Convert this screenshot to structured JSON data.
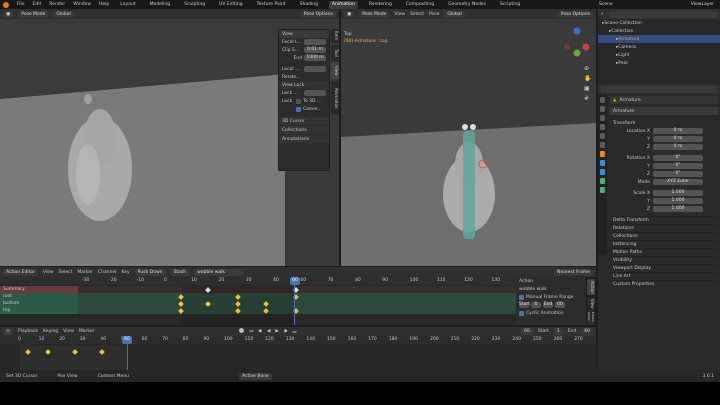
{
  "topbar": {
    "menus": [
      "File",
      "Edit",
      "Render",
      "Window",
      "Help"
    ],
    "workspaces": [
      "Layout",
      "Modeling",
      "Sculpting",
      "UV Editing",
      "Texture Paint",
      "Shading",
      "Animation",
      "Rendering",
      "Compositing",
      "Geometry Nodes",
      "Scripting"
    ],
    "active_workspace": "Animation",
    "scene": "Scene",
    "view_layer": "ViewLayer"
  },
  "left_viewport": {
    "mode": "Pose Mode",
    "orientation": "Global",
    "pose_options": "Pose Options",
    "side_tabs": [
      "Item",
      "Tool",
      "View",
      "Animation"
    ],
    "view_panel": {
      "title": "View",
      "focal_label": "Focal L...",
      "clip_start_label": "Clip S...",
      "clip_start_value": "0.01 m",
      "end_label": "End",
      "end_value": "1000 m",
      "local_label": "Local ...",
      "render_label": "Rende...",
      "view_lock_title": "View Lock",
      "lock_obj_label": "Lock ...",
      "lock_label": "Lock",
      "to_3d_label": "To 3D ...",
      "camera_label": "Camer...",
      "sections": [
        "3D Cursor",
        "Collections",
        "Annotations"
      ]
    }
  },
  "right_viewport": {
    "mode": "Pose Mode",
    "menus": [
      "View",
      "Select",
      "Pose"
    ],
    "orientation": "Global",
    "pose_options": "Pose Options",
    "info_line1": "Top",
    "info_line2": "(60) Armature : top"
  },
  "outliner": {
    "items": [
      {
        "label": "Scene Collection",
        "indent": 0,
        "color": "#c8c8c8"
      },
      {
        "label": "Collection",
        "indent": 1,
        "color": "#c8c8c8"
      },
      {
        "label": "Armature",
        "indent": 2,
        "color": "#e89a3c",
        "selected": true
      },
      {
        "label": "Camera",
        "indent": 2,
        "color": "#c8c8c8"
      },
      {
        "label": "Light",
        "indent": 2,
        "color": "#c8c8c8"
      },
      {
        "label": "Pear",
        "indent": 2,
        "color": "#c8c8c8"
      }
    ]
  },
  "properties": {
    "object_name": "Armature",
    "data_name": "Armature",
    "transform_title": "Transform",
    "location_label": "Location X",
    "location": [
      "0 m",
      "0 m",
      "0 m"
    ],
    "rotation_label": "Rotation X",
    "rotation": [
      "0°",
      "0°",
      "0°"
    ],
    "mode_label": "Mode",
    "mode_value": "XYZ Euler",
    "scale_label": "Scale X",
    "scale": [
      "1.000",
      "1.000",
      "1.000"
    ],
    "axis_y": "Y",
    "axis_z": "Z",
    "sections": [
      "Delta Transform",
      "Relations",
      "Collections",
      "Instancing",
      "Motion Paths",
      "Visibility",
      "Viewport Display",
      "Line Art",
      "Custom Properties"
    ]
  },
  "action_editor": {
    "editor_label": "Action Editor",
    "menus": [
      "View",
      "Select",
      "Marker",
      "Channel",
      "Key"
    ],
    "push_down": "Push Down",
    "stash": "Stash",
    "action_name": "wobble walk",
    "nearest_frame": "Nearest Frame",
    "ruler": [
      "-30",
      "-20",
      "-10",
      "0",
      "10",
      "20",
      "30",
      "40",
      "60",
      "70",
      "80",
      "90",
      "100",
      "110",
      "120",
      "130"
    ],
    "channels": [
      {
        "name": "Summary",
        "color": "#6b3a3a"
      },
      {
        "name": "root",
        "color": "#2b5a46"
      },
      {
        "name": "bottom",
        "color": "#2b5a46"
      },
      {
        "name": "top",
        "color": "#2b5a46"
      }
    ],
    "current_frame": "60",
    "sidebar": {
      "title": "Action",
      "action_label": "wobble walk",
      "manual_range": "Manual Frame Range",
      "start_label": "Start",
      "start_value": "0",
      "end_label": "End",
      "end_value": "60",
      "cyclic": "Cyclic Animation",
      "tabs": [
        "Action",
        "View",
        "Edited Action"
      ]
    }
  },
  "timeline": {
    "menus": [
      "Playback",
      "Keying",
      "View",
      "Marker"
    ],
    "current_frame": "60",
    "start_label": "Start",
    "start_value": "1",
    "end_label": "End",
    "end_value": "60",
    "ruler": [
      "0",
      "10",
      "20",
      "30",
      "40",
      "50",
      "60",
      "70",
      "80",
      "90",
      "100",
      "110",
      "120",
      "130",
      "140",
      "150",
      "160",
      "170",
      "180",
      "190",
      "200",
      "210",
      "220",
      "230",
      "240",
      "250",
      "260",
      "270"
    ]
  },
  "status_bar": {
    "items": [
      "Set 3D Cursor",
      "Pan View",
      "Context Menu"
    ],
    "mode_badge": "Active Bone",
    "version": "3.6.1"
  },
  "colors": {
    "accent": "#4772b3",
    "keyframe": "#f2c12e",
    "playhead": "#4772b3",
    "active_workspace": "#3d3d3d"
  }
}
